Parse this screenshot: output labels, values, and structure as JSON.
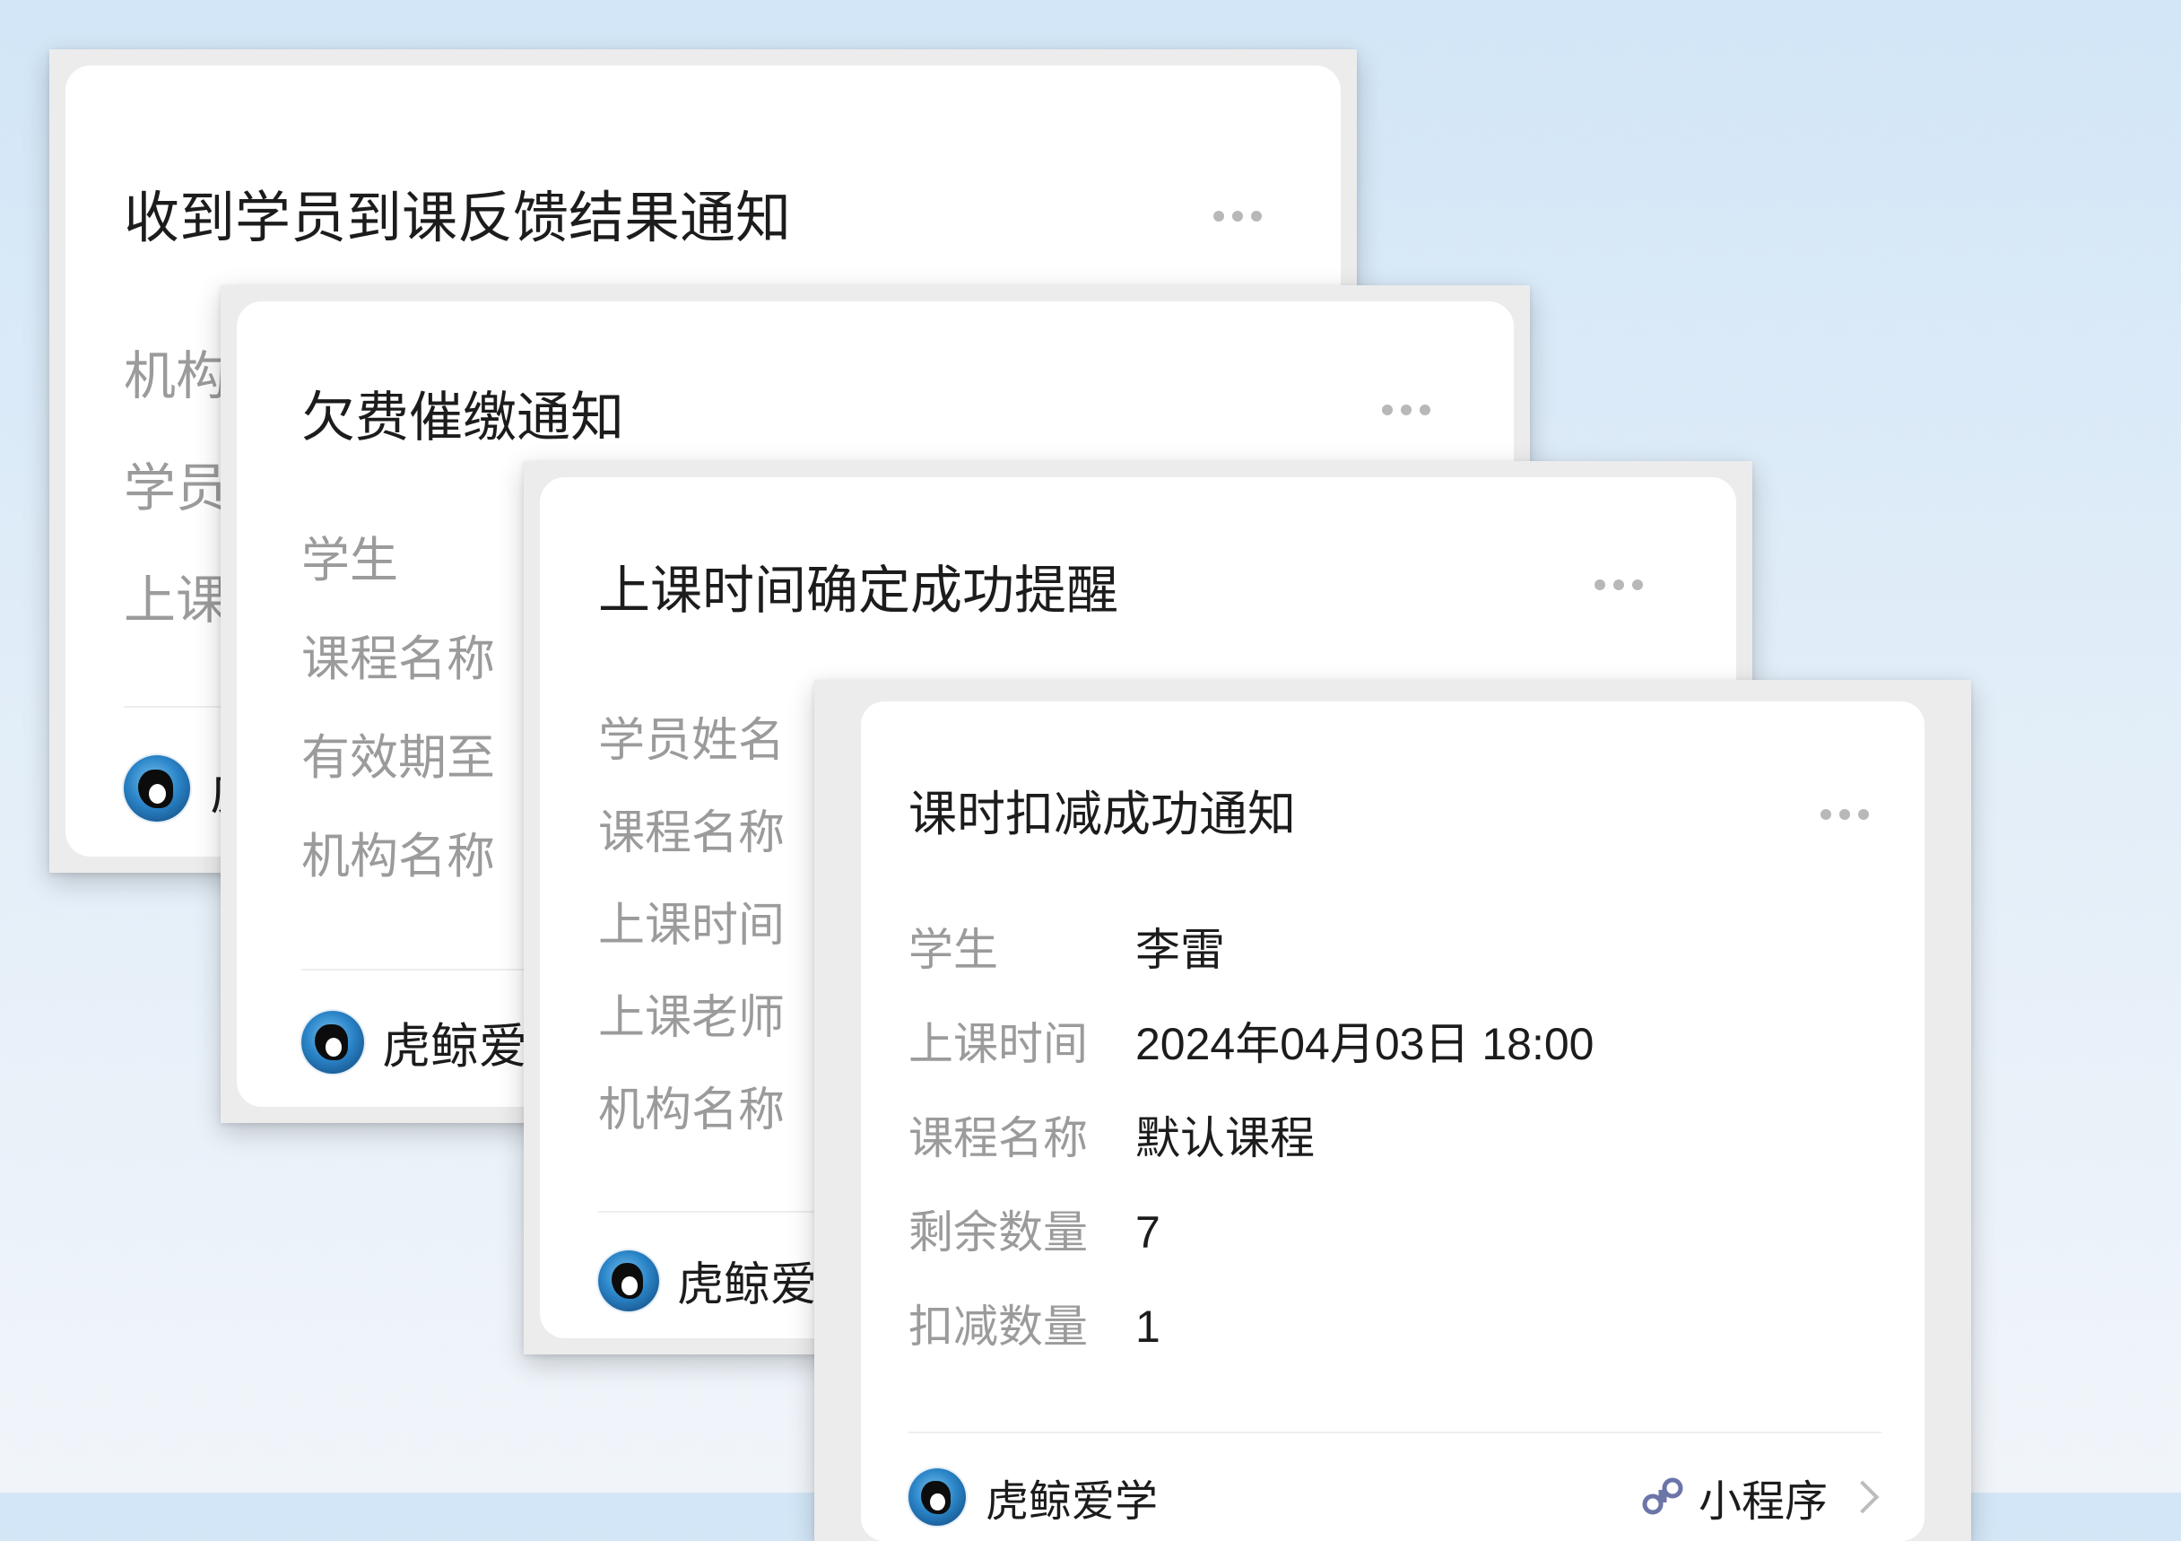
{
  "cards": [
    {
      "title": "收到学员到课反馈结果通知",
      "fields": [
        {
          "label": "机构"
        },
        {
          "label": "学员"
        },
        {
          "label": "上课"
        }
      ],
      "footer": {
        "brand": "虎"
      }
    },
    {
      "title": "欠费催缴通知",
      "fields": [
        {
          "label": "学生"
        },
        {
          "label": "课程名称"
        },
        {
          "label": "有效期至"
        },
        {
          "label": "机构名称"
        }
      ],
      "footer": {
        "brand": "虎鲸爱"
      }
    },
    {
      "title": "上课时间确定成功提醒",
      "fields": [
        {
          "label": "学员姓名"
        },
        {
          "label": "课程名称"
        },
        {
          "label": "上课时间"
        },
        {
          "label": "上课老师"
        },
        {
          "label": "机构名称"
        }
      ],
      "footer": {
        "brand": "虎鲸爱"
      }
    },
    {
      "title": "课时扣减成功通知",
      "fields": [
        {
          "label": "学生",
          "value": "李雷"
        },
        {
          "label": "上课时间",
          "value": "2024年04月03日 18:00"
        },
        {
          "label": "课程名称",
          "value": "默认课程"
        },
        {
          "label": "剩余数量",
          "value": "7"
        },
        {
          "label": "扣减数量",
          "value": "1"
        }
      ],
      "footer": {
        "brand": "虎鲸爱学",
        "mini_program": "小程序"
      }
    }
  ],
  "icons": {
    "avatar": "orca-logo-avatar",
    "more": "more-dots-icon",
    "mini_program": "mini-program-icon",
    "chevron": "chevron-right-icon"
  }
}
